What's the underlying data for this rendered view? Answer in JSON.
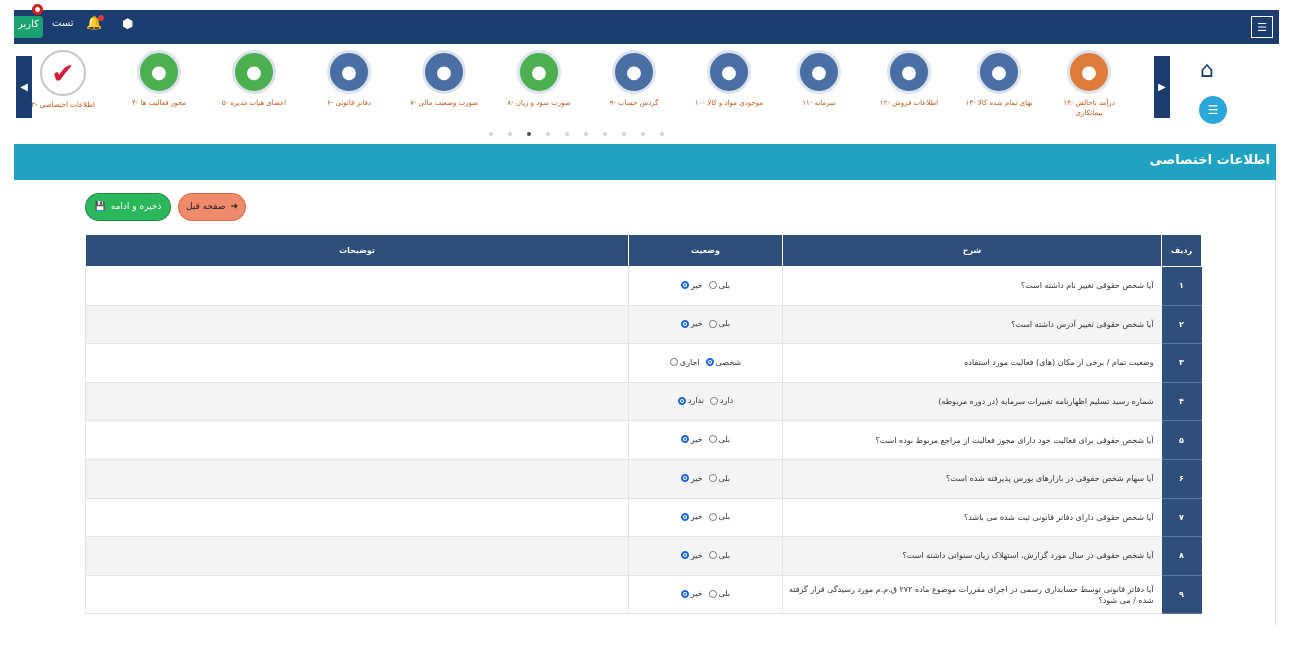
{
  "topbar": {
    "user_chip": "کاربر",
    "user_name": "تست",
    "menu_icon": "hamburger-icon",
    "bell_icon": "bell-icon",
    "box_icon": "package-icon"
  },
  "steps": [
    {
      "label": "۳- اطلاعات اختصاصی",
      "icon": "checkmark-icon",
      "color": "#ffffff",
      "active": true
    },
    {
      "label": "۴- مجوز فعالیت ها",
      "icon": "license-icon",
      "color": "#4caf50"
    },
    {
      "label": "۵- اعضای هیات مدیره",
      "icon": "board-members-icon",
      "color": "#4caf50"
    },
    {
      "label": "۶- دفاتر قانونی",
      "icon": "ledger-icon",
      "color": "#4a6fa5"
    },
    {
      "label": "۷- صورت وضعیت مالی",
      "icon": "calculator-icon",
      "color": "#4a6fa5"
    },
    {
      "label": "۸- صورت سود و زیان",
      "icon": "scales-icon",
      "color": "#4caf50"
    },
    {
      "label": "۹- گردش حساب",
      "icon": "flow-icon",
      "color": "#4a6fa5"
    },
    {
      "label": "۱۰- موجودی مواد و کالا",
      "icon": "inventory-icon",
      "color": "#4a6fa5"
    },
    {
      "label": "۱۱- سرمایه",
      "icon": "money-bag-icon",
      "color": "#4a6fa5"
    },
    {
      "label": "۱۲- اطلاعات فروش",
      "icon": "sales-info-icon",
      "color": "#4a6fa5"
    },
    {
      "label": "۱۳- بهای تمام شده کالا",
      "icon": "cost-icon",
      "color": "#4a6fa5"
    },
    {
      "label": "۱۴- درآمد ناخالص پیمانکاری",
      "icon": "contract-income-icon",
      "color": "#e07a3a"
    }
  ],
  "section": {
    "title": "اطلاعات اختصاصی"
  },
  "buttons": {
    "save": "ذخیره و ادامه",
    "prev": "صفحه قبل"
  },
  "table": {
    "headers": {
      "row": "ردیف",
      "desc": "شرح",
      "status": "وضعیت",
      "notes": "توضیحات"
    },
    "rows": [
      {
        "num": "۱",
        "desc": "آیا شخص حقوقی تغییر نام داشته است؟",
        "opt1": "بلی",
        "opt2": "خیر",
        "sel": 2
      },
      {
        "num": "۲",
        "desc": "آیا شخص حقوقی تغییر آدرس داشته است؟",
        "opt1": "بلی",
        "opt2": "خیر",
        "sel": 2
      },
      {
        "num": "۳",
        "desc": "وضعیت تمام / برخی از مکان (های) فعالیت مورد استفاده",
        "opt1": "شخصی",
        "opt2": "اجاری",
        "sel": 1
      },
      {
        "num": "۴",
        "desc": "شماره رسید تسلیم اظهارنامه تغییرات سرمایه (در دوره مربوطه)",
        "opt1": "دارد",
        "opt2": "ندارد",
        "sel": 2
      },
      {
        "num": "۵",
        "desc": "آیا شخص حقوقی برای فعالیت خود دارای مجوز فعالیت از مراجع مربوط بوده است؟",
        "opt1": "بلی",
        "opt2": "خیر",
        "sel": 2
      },
      {
        "num": "۶",
        "desc": "آیا سهام شخص حقوقی در بازارهای بورس پذیرفته شده است؟",
        "opt1": "بلی",
        "opt2": "خیر",
        "sel": 2
      },
      {
        "num": "۷",
        "desc": "آیا شخص حقوقی دارای دفاتر قانونی ثبت شده می باشد؟",
        "opt1": "بلی",
        "opt2": "خیر",
        "sel": 2
      },
      {
        "num": "۸",
        "desc": "آیا شخص حقوقی در سال مورد گزارش، استهلاک زیان سنواتی داشته است؟",
        "opt1": "بلی",
        "opt2": "خیر",
        "sel": 2
      },
      {
        "num": "۹",
        "desc": "آیا دفاتر قانونی توسط حسابداری رسمی در اجرای مقررات موضوع ماده ۲۷۲ ق.م.م مورد رسیدگی قرار گرفته شده / می شود؟",
        "opt1": "بلی",
        "opt2": "خیر",
        "sel": 2
      }
    ]
  }
}
